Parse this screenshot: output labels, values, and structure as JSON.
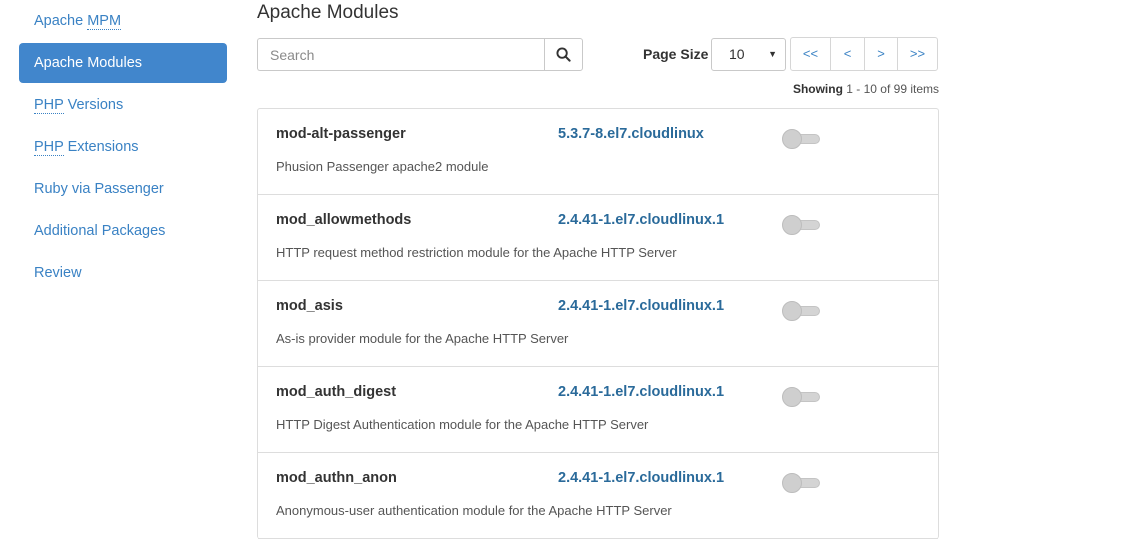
{
  "sidebar": {
    "items": [
      {
        "prefix": "Apache ",
        "abbr": "MPM",
        "suffix": "",
        "active": false
      },
      {
        "prefix": "Apache Modules",
        "abbr": "",
        "suffix": "",
        "active": true
      },
      {
        "prefix": "",
        "abbr": "PHP",
        "suffix": " Versions",
        "active": false
      },
      {
        "prefix": "",
        "abbr": "PHP",
        "suffix": " Extensions",
        "active": false
      },
      {
        "prefix": "Ruby via Passenger",
        "abbr": "",
        "suffix": "",
        "active": false
      },
      {
        "prefix": "Additional Packages",
        "abbr": "",
        "suffix": "",
        "active": false
      },
      {
        "prefix": "Review",
        "abbr": "",
        "suffix": "",
        "active": false
      }
    ]
  },
  "main": {
    "title": "Apache Modules",
    "search": {
      "placeholder": "Search",
      "value": ""
    },
    "page_size": {
      "label": "Page Size",
      "value": "10"
    },
    "pager": {
      "first": "<<",
      "prev": "<",
      "next": ">",
      "last": ">>"
    },
    "showing": {
      "label": "Showing",
      "range": "1 - 10 of 99 items"
    },
    "modules": [
      {
        "name": "mod-alt-passenger",
        "version": "5.3.7-8.el7.cloudlinux",
        "description": "Phusion Passenger apache2 module",
        "enabled": false
      },
      {
        "name": "mod_allowmethods",
        "version": "2.4.41-1.el7.cloudlinux.1",
        "description": "HTTP request method restriction module for the Apache HTTP Server",
        "enabled": false
      },
      {
        "name": "mod_asis",
        "version": "2.4.41-1.el7.cloudlinux.1",
        "description": "As-is provider module for the Apache HTTP Server",
        "enabled": false
      },
      {
        "name": "mod_auth_digest",
        "version": "2.4.41-1.el7.cloudlinux.1",
        "description": "HTTP Digest Authentication module for the Apache HTTP Server",
        "enabled": false
      },
      {
        "name": "mod_authn_anon",
        "version": "2.4.41-1.el7.cloudlinux.1",
        "description": "Anonymous-user authentication module for the Apache HTTP Server",
        "enabled": false
      }
    ]
  },
  "colors": {
    "accent": "#4186cc",
    "link": "#3a82c4",
    "version": "#2a6a9a"
  }
}
